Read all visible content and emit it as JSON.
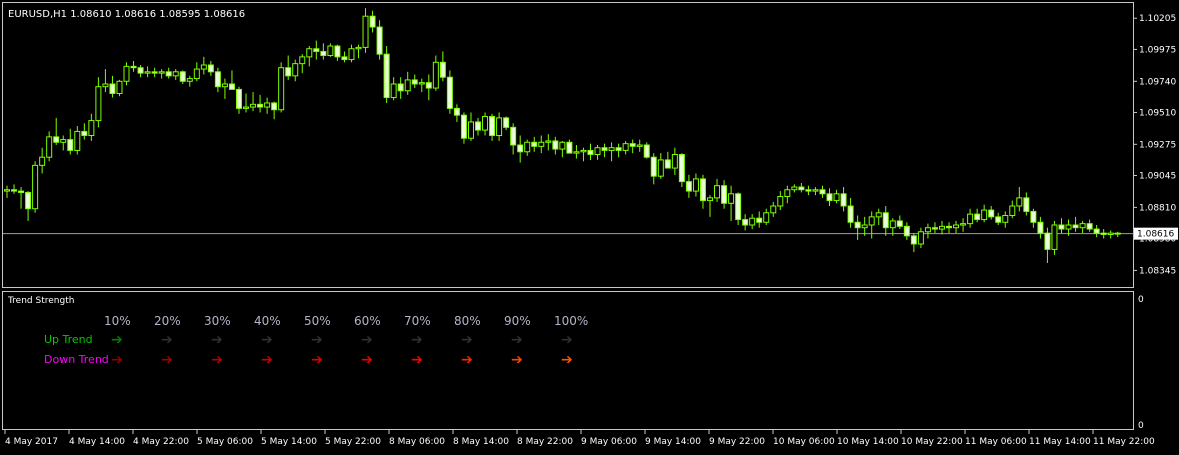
{
  "symbol_header": "EURUSD,H1  1.08610 1.08616 1.08595 1.08616",
  "current_price_label": "1.08616",
  "colors": {
    "background": "#000000",
    "frame": "#c8c8c8",
    "candle": "#7fff00",
    "bull_body": "#e8ffd8",
    "bear_body": "#7fff00",
    "text": "#ffffff",
    "up_trend": "#00c800",
    "down_trend": "#ff00ff"
  },
  "indicator": {
    "title": "Trend Strength",
    "axis_top": "0",
    "axis_bottom": "0",
    "percent_labels": [
      "10%",
      "20%",
      "30%",
      "40%",
      "50%",
      "60%",
      "70%",
      "80%",
      "90%",
      "100%"
    ],
    "up_label": "Up Trend",
    "down_label": "Down Trend",
    "up_arrow_colors": [
      "#008000",
      "#303030",
      "#303030",
      "#303030",
      "#303030",
      "#303030",
      "#303030",
      "#303030",
      "#303030",
      "#303030"
    ],
    "down_arrow_colors": [
      "#8b0000",
      "#a00000",
      "#b40000",
      "#c80000",
      "#dc0000",
      "#ef0000",
      "#ff0000",
      "#ff2200",
      "#ff4400",
      "#ff5500"
    ],
    "arrow_glyph": "➔"
  },
  "chart_data": {
    "type": "candlestick",
    "title": "EURUSD,H1",
    "price_ticks": [
      "1.10205",
      "1.09975",
      "1.09740",
      "1.09510",
      "1.09275",
      "1.09045",
      "1.08810",
      "1.08580",
      "1.08345"
    ],
    "ylim": [
      1.0823,
      1.1031
    ],
    "current_price": 1.08616,
    "time_labels": [
      "4 May 2017",
      "4 May 14:00",
      "4 May 22:00",
      "5 May 06:00",
      "5 May 14:00",
      "5 May 22:00",
      "8 May 06:00",
      "8 May 14:00",
      "8 May 22:00",
      "9 May 06:00",
      "9 May 14:00",
      "9 May 22:00",
      "10 May 06:00",
      "10 May 14:00",
      "10 May 22:00",
      "11 May 06:00",
      "11 May 14:00",
      "11 May 22:00"
    ],
    "candles": [
      {
        "o": 1.0893,
        "h": 1.0897,
        "l": 1.0888,
        "c": 1.0894
      },
      {
        "o": 1.0894,
        "h": 1.0898,
        "l": 1.0891,
        "c": 1.0893
      },
      {
        "o": 1.0893,
        "h": 1.0896,
        "l": 1.088,
        "c": 1.0892
      },
      {
        "o": 1.0892,
        "h": 1.0893,
        "l": 1.0871,
        "c": 1.088
      },
      {
        "o": 1.088,
        "h": 1.0915,
        "l": 1.0877,
        "c": 1.0912
      },
      {
        "o": 1.0912,
        "h": 1.0925,
        "l": 1.0906,
        "c": 1.0918
      },
      {
        "o": 1.0918,
        "h": 1.0937,
        "l": 1.0915,
        "c": 1.0933
      },
      {
        "o": 1.0933,
        "h": 1.0947,
        "l": 1.0927,
        "c": 1.0929
      },
      {
        "o": 1.0929,
        "h": 1.0934,
        "l": 1.0923,
        "c": 1.0931
      },
      {
        "o": 1.0931,
        "h": 1.0939,
        "l": 1.092,
        "c": 1.0923
      },
      {
        "o": 1.0923,
        "h": 1.0941,
        "l": 1.092,
        "c": 1.0937
      },
      {
        "o": 1.0937,
        "h": 1.0943,
        "l": 1.0931,
        "c": 1.0934
      },
      {
        "o": 1.0934,
        "h": 1.095,
        "l": 1.093,
        "c": 1.0945
      },
      {
        "o": 1.0945,
        "h": 1.0977,
        "l": 1.094,
        "c": 1.097
      },
      {
        "o": 1.097,
        "h": 1.0983,
        "l": 1.0966,
        "c": 1.0972
      },
      {
        "o": 1.0972,
        "h": 1.0978,
        "l": 1.0962,
        "c": 1.0965
      },
      {
        "o": 1.0965,
        "h": 1.0975,
        "l": 1.0963,
        "c": 1.0974
      },
      {
        "o": 1.0974,
        "h": 1.0988,
        "l": 1.0971,
        "c": 1.0985
      },
      {
        "o": 1.0985,
        "h": 1.0989,
        "l": 1.0981,
        "c": 1.0984
      },
      {
        "o": 1.0984,
        "h": 1.0986,
        "l": 1.0977,
        "c": 1.098
      },
      {
        "o": 1.098,
        "h": 1.0985,
        "l": 1.0977,
        "c": 1.0981
      },
      {
        "o": 1.0981,
        "h": 1.0984,
        "l": 1.0977,
        "c": 1.098
      },
      {
        "o": 1.098,
        "h": 1.0983,
        "l": 1.0976,
        "c": 1.0981
      },
      {
        "o": 1.0981,
        "h": 1.0984,
        "l": 1.0976,
        "c": 1.0978
      },
      {
        "o": 1.0978,
        "h": 1.0983,
        "l": 1.0975,
        "c": 1.0981
      },
      {
        "o": 1.0981,
        "h": 1.0982,
        "l": 1.0972,
        "c": 1.0974
      },
      {
        "o": 1.0974,
        "h": 1.0978,
        "l": 1.097,
        "c": 1.0976
      },
      {
        "o": 1.0976,
        "h": 1.0988,
        "l": 1.0974,
        "c": 1.0983
      },
      {
        "o": 1.0983,
        "h": 1.0992,
        "l": 1.0979,
        "c": 1.0986
      },
      {
        "o": 1.0986,
        "h": 1.0989,
        "l": 1.0978,
        "c": 1.0981
      },
      {
        "o": 1.0981,
        "h": 1.0984,
        "l": 1.0966,
        "c": 1.097
      },
      {
        "o": 1.097,
        "h": 1.0976,
        "l": 1.0961,
        "c": 1.0972
      },
      {
        "o": 1.0972,
        "h": 1.0982,
        "l": 1.0969,
        "c": 1.0968
      },
      {
        "o": 1.0968,
        "h": 1.097,
        "l": 1.095,
        "c": 1.0954
      },
      {
        "o": 1.0954,
        "h": 1.0965,
        "l": 1.0951,
        "c": 1.0955
      },
      {
        "o": 1.0955,
        "h": 1.0966,
        "l": 1.0952,
        "c": 1.0957
      },
      {
        "o": 1.0957,
        "h": 1.0964,
        "l": 1.0951,
        "c": 1.0955
      },
      {
        "o": 1.0955,
        "h": 1.0962,
        "l": 1.095,
        "c": 1.0958
      },
      {
        "o": 1.0958,
        "h": 1.0959,
        "l": 1.0946,
        "c": 1.0953
      },
      {
        "o": 1.0953,
        "h": 1.0988,
        "l": 1.0951,
        "c": 1.0984
      },
      {
        "o": 1.0984,
        "h": 1.0993,
        "l": 1.0975,
        "c": 1.0978
      },
      {
        "o": 1.0978,
        "h": 1.099,
        "l": 1.0974,
        "c": 1.0987
      },
      {
        "o": 1.0987,
        "h": 1.0994,
        "l": 1.098,
        "c": 1.0992
      },
      {
        "o": 1.0992,
        "h": 1.1,
        "l": 1.0985,
        "c": 1.0998
      },
      {
        "o": 1.0998,
        "h": 1.1004,
        "l": 1.099,
        "c": 1.0996
      },
      {
        "o": 1.0996,
        "h": 1.1002,
        "l": 1.099,
        "c": 1.0993
      },
      {
        "o": 1.0993,
        "h": 1.1002,
        "l": 1.0992,
        "c": 1.1
      },
      {
        "o": 1.1,
        "h": 1.1001,
        "l": 1.0989,
        "c": 1.0992
      },
      {
        "o": 1.0992,
        "h": 1.0996,
        "l": 1.0988,
        "c": 1.099
      },
      {
        "o": 1.099,
        "h": 1.1001,
        "l": 1.0988,
        "c": 1.0998
      },
      {
        "o": 1.0998,
        "h": 1.1001,
        "l": 1.0991,
        "c": 1.0999
      },
      {
        "o": 1.0999,
        "h": 1.1028,
        "l": 1.0995,
        "c": 1.1022
      },
      {
        "o": 1.1022,
        "h": 1.1026,
        "l": 1.101,
        "c": 1.1014
      },
      {
        "o": 1.1014,
        "h": 1.1019,
        "l": 1.099,
        "c": 1.0994
      },
      {
        "o": 1.0994,
        "h": 1.1,
        "l": 1.0958,
        "c": 1.0962
      },
      {
        "o": 1.0962,
        "h": 1.0977,
        "l": 1.096,
        "c": 1.0972
      },
      {
        "o": 1.0972,
        "h": 1.0977,
        "l": 1.0961,
        "c": 1.0967
      },
      {
        "o": 1.0967,
        "h": 1.0981,
        "l": 1.0964,
        "c": 1.0975
      },
      {
        "o": 1.0975,
        "h": 1.0979,
        "l": 1.0969,
        "c": 1.0972
      },
      {
        "o": 1.0972,
        "h": 1.0976,
        "l": 1.0966,
        "c": 1.0973
      },
      {
        "o": 1.0973,
        "h": 1.0979,
        "l": 1.096,
        "c": 1.0969
      },
      {
        "o": 1.0969,
        "h": 1.0993,
        "l": 1.0967,
        "c": 1.0988
      },
      {
        "o": 1.0988,
        "h": 1.0996,
        "l": 1.0974,
        "c": 1.0977
      },
      {
        "o": 1.0977,
        "h": 1.0982,
        "l": 1.095,
        "c": 1.0954
      },
      {
        "o": 1.0954,
        "h": 1.0957,
        "l": 1.0944,
        "c": 1.0949
      },
      {
        "o": 1.0949,
        "h": 1.0951,
        "l": 1.0928,
        "c": 1.0932
      },
      {
        "o": 1.0932,
        "h": 1.0951,
        "l": 1.093,
        "c": 1.0944
      },
      {
        "o": 1.0944,
        "h": 1.0947,
        "l": 1.0934,
        "c": 1.0938
      },
      {
        "o": 1.0938,
        "h": 1.0951,
        "l": 1.0934,
        "c": 1.0948
      },
      {
        "o": 1.0948,
        "h": 1.095,
        "l": 1.093,
        "c": 1.0934
      },
      {
        "o": 1.0934,
        "h": 1.0951,
        "l": 1.093,
        "c": 1.0947
      },
      {
        "o": 1.0947,
        "h": 1.0948,
        "l": 1.0938,
        "c": 1.094
      },
      {
        "o": 1.094,
        "h": 1.0943,
        "l": 1.092,
        "c": 1.0927
      },
      {
        "o": 1.0927,
        "h": 1.0934,
        "l": 1.0914,
        "c": 1.0922
      },
      {
        "o": 1.0922,
        "h": 1.0931,
        "l": 1.0919,
        "c": 1.0929
      },
      {
        "o": 1.0929,
        "h": 1.0933,
        "l": 1.0922,
        "c": 1.0926
      },
      {
        "o": 1.0926,
        "h": 1.0934,
        "l": 1.0921,
        "c": 1.0929
      },
      {
        "o": 1.0929,
        "h": 1.0935,
        "l": 1.0923,
        "c": 1.093
      },
      {
        "o": 1.093,
        "h": 1.0933,
        "l": 1.092,
        "c": 1.0924
      },
      {
        "o": 1.0924,
        "h": 1.093,
        "l": 1.0918,
        "c": 1.0929
      },
      {
        "o": 1.0929,
        "h": 1.0931,
        "l": 1.0921,
        "c": 1.0921
      },
      {
        "o": 1.0921,
        "h": 1.0927,
        "l": 1.0917,
        "c": 1.0922
      },
      {
        "o": 1.0922,
        "h": 1.0925,
        "l": 1.0915,
        "c": 1.0923
      },
      {
        "o": 1.0923,
        "h": 1.0928,
        "l": 1.0916,
        "c": 1.092
      },
      {
        "o": 1.092,
        "h": 1.0927,
        "l": 1.0916,
        "c": 1.0925
      },
      {
        "o": 1.0925,
        "h": 1.0928,
        "l": 1.0918,
        "c": 1.0923
      },
      {
        "o": 1.0923,
        "h": 1.0929,
        "l": 1.0915,
        "c": 1.0925
      },
      {
        "o": 1.0925,
        "h": 1.0928,
        "l": 1.0918,
        "c": 1.0923
      },
      {
        "o": 1.0923,
        "h": 1.093,
        "l": 1.092,
        "c": 1.0928
      },
      {
        "o": 1.0928,
        "h": 1.0931,
        "l": 1.0921,
        "c": 1.0926
      },
      {
        "o": 1.0926,
        "h": 1.0931,
        "l": 1.0922,
        "c": 1.0927
      },
      {
        "o": 1.0927,
        "h": 1.0929,
        "l": 1.0917,
        "c": 1.0918
      },
      {
        "o": 1.0918,
        "h": 1.0921,
        "l": 1.0898,
        "c": 1.0904
      },
      {
        "o": 1.0904,
        "h": 1.0921,
        "l": 1.0902,
        "c": 1.0916
      },
      {
        "o": 1.0916,
        "h": 1.0922,
        "l": 1.091,
        "c": 1.091
      },
      {
        "o": 1.091,
        "h": 1.0925,
        "l": 1.0905,
        "c": 1.092
      },
      {
        "o": 1.092,
        "h": 1.0921,
        "l": 1.0896,
        "c": 1.09
      },
      {
        "o": 1.09,
        "h": 1.0905,
        "l": 1.0888,
        "c": 1.0893
      },
      {
        "o": 1.0893,
        "h": 1.0906,
        "l": 1.0889,
        "c": 1.0902
      },
      {
        "o": 1.0902,
        "h": 1.0905,
        "l": 1.088,
        "c": 1.0886
      },
      {
        "o": 1.0886,
        "h": 1.089,
        "l": 1.0874,
        "c": 1.0888
      },
      {
        "o": 1.0888,
        "h": 1.0902,
        "l": 1.0885,
        "c": 1.0897
      },
      {
        "o": 1.0897,
        "h": 1.0901,
        "l": 1.088,
        "c": 1.0884
      },
      {
        "o": 1.0884,
        "h": 1.0897,
        "l": 1.0871,
        "c": 1.0891
      },
      {
        "o": 1.0891,
        "h": 1.0892,
        "l": 1.0868,
        "c": 1.0872
      },
      {
        "o": 1.0872,
        "h": 1.0876,
        "l": 1.0864,
        "c": 1.0868
      },
      {
        "o": 1.0868,
        "h": 1.0876,
        "l": 1.0865,
        "c": 1.0873
      },
      {
        "o": 1.0873,
        "h": 1.0878,
        "l": 1.0866,
        "c": 1.087
      },
      {
        "o": 1.087,
        "h": 1.088,
        "l": 1.0868,
        "c": 1.0877
      },
      {
        "o": 1.0877,
        "h": 1.0885,
        "l": 1.0874,
        "c": 1.0882
      },
      {
        "o": 1.0882,
        "h": 1.0893,
        "l": 1.0879,
        "c": 1.0889
      },
      {
        "o": 1.0889,
        "h": 1.0897,
        "l": 1.0884,
        "c": 1.0894
      },
      {
        "o": 1.0894,
        "h": 1.0898,
        "l": 1.0892,
        "c": 1.0896
      },
      {
        "o": 1.0896,
        "h": 1.0899,
        "l": 1.0892,
        "c": 1.0894
      },
      {
        "o": 1.0894,
        "h": 1.0897,
        "l": 1.089,
        "c": 1.0893
      },
      {
        "o": 1.0893,
        "h": 1.0896,
        "l": 1.089,
        "c": 1.0894
      },
      {
        "o": 1.0894,
        "h": 1.0897,
        "l": 1.0888,
        "c": 1.0891
      },
      {
        "o": 1.0891,
        "h": 1.0895,
        "l": 1.0882,
        "c": 1.0886
      },
      {
        "o": 1.0886,
        "h": 1.0894,
        "l": 1.0884,
        "c": 1.0891
      },
      {
        "o": 1.0891,
        "h": 1.0896,
        "l": 1.0878,
        "c": 1.0882
      },
      {
        "o": 1.0882,
        "h": 1.0888,
        "l": 1.0866,
        "c": 1.087
      },
      {
        "o": 1.087,
        "h": 1.0875,
        "l": 1.0857,
        "c": 1.0866
      },
      {
        "o": 1.0866,
        "h": 1.0874,
        "l": 1.086,
        "c": 1.0868
      },
      {
        "o": 1.0868,
        "h": 1.0878,
        "l": 1.0858,
        "c": 1.0874
      },
      {
        "o": 1.0874,
        "h": 1.088,
        "l": 1.0868,
        "c": 1.0877
      },
      {
        "o": 1.0877,
        "h": 1.0882,
        "l": 1.086,
        "c": 1.0866
      },
      {
        "o": 1.0866,
        "h": 1.0873,
        "l": 1.086,
        "c": 1.0871
      },
      {
        "o": 1.0871,
        "h": 1.0875,
        "l": 1.0865,
        "c": 1.0867
      },
      {
        "o": 1.0867,
        "h": 1.087,
        "l": 1.0857,
        "c": 1.086
      },
      {
        "o": 1.086,
        "h": 1.0862,
        "l": 1.0848,
        "c": 1.0854
      },
      {
        "o": 1.0854,
        "h": 1.0866,
        "l": 1.0851,
        "c": 1.0863
      },
      {
        "o": 1.0863,
        "h": 1.0869,
        "l": 1.0858,
        "c": 1.0866
      },
      {
        "o": 1.0866,
        "h": 1.087,
        "l": 1.0862,
        "c": 1.0865
      },
      {
        "o": 1.0865,
        "h": 1.0871,
        "l": 1.0861,
        "c": 1.0867
      },
      {
        "o": 1.0867,
        "h": 1.087,
        "l": 1.0862,
        "c": 1.0866
      },
      {
        "o": 1.0866,
        "h": 1.0871,
        "l": 1.0862,
        "c": 1.0868
      },
      {
        "o": 1.0868,
        "h": 1.0873,
        "l": 1.0863,
        "c": 1.0869
      },
      {
        "o": 1.0869,
        "h": 1.088,
        "l": 1.0866,
        "c": 1.0876
      },
      {
        "o": 1.0876,
        "h": 1.088,
        "l": 1.087,
        "c": 1.0872
      },
      {
        "o": 1.0872,
        "h": 1.0883,
        "l": 1.087,
        "c": 1.0879
      },
      {
        "o": 1.0879,
        "h": 1.0882,
        "l": 1.0872,
        "c": 1.0874
      },
      {
        "o": 1.0874,
        "h": 1.0877,
        "l": 1.0868,
        "c": 1.087
      },
      {
        "o": 1.087,
        "h": 1.0878,
        "l": 1.0866,
        "c": 1.0875
      },
      {
        "o": 1.0875,
        "h": 1.0886,
        "l": 1.0873,
        "c": 1.0882
      },
      {
        "o": 1.0882,
        "h": 1.0896,
        "l": 1.0878,
        "c": 1.0888
      },
      {
        "o": 1.0888,
        "h": 1.0892,
        "l": 1.0875,
        "c": 1.0878
      },
      {
        "o": 1.0878,
        "h": 1.088,
        "l": 1.0866,
        "c": 1.087
      },
      {
        "o": 1.087,
        "h": 1.0874,
        "l": 1.0858,
        "c": 1.0862
      },
      {
        "o": 1.0862,
        "h": 1.0866,
        "l": 1.084,
        "c": 1.085
      },
      {
        "o": 1.085,
        "h": 1.0871,
        "l": 1.0846,
        "c": 1.0868
      },
      {
        "o": 1.0868,
        "h": 1.0873,
        "l": 1.0862,
        "c": 1.0865
      },
      {
        "o": 1.0865,
        "h": 1.0872,
        "l": 1.086,
        "c": 1.0868
      },
      {
        "o": 1.0868,
        "h": 1.0874,
        "l": 1.0863,
        "c": 1.0866
      },
      {
        "o": 1.0866,
        "h": 1.0871,
        "l": 1.0862,
        "c": 1.0869
      },
      {
        "o": 1.0869,
        "h": 1.0872,
        "l": 1.0863,
        "c": 1.0865
      },
      {
        "o": 1.0865,
        "h": 1.0868,
        "l": 1.0859,
        "c": 1.0862
      },
      {
        "o": 1.0862,
        "h": 1.0865,
        "l": 1.0858,
        "c": 1.0861
      },
      {
        "o": 1.0861,
        "h": 1.0864,
        "l": 1.0858,
        "c": 1.0862
      },
      {
        "o": 1.0862,
        "h": 1.0863,
        "l": 1.0859,
        "c": 1.08616
      }
    ]
  }
}
